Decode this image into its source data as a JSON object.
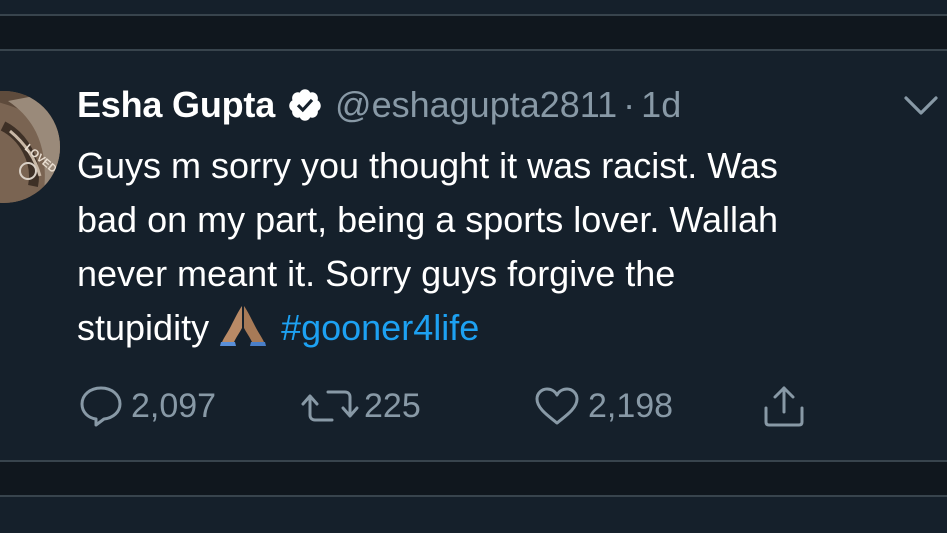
{
  "tweet": {
    "author_name": "Esha Gupta",
    "handle": "@eshagupta2811",
    "separator": "·",
    "time": "1d",
    "text_lines": [
      "Guys m sorry you thought it was racist. Was",
      "bad on my part, being a sports lover. Wallah",
      "never meant it. Sorry guys forgive the",
      "stupidity"
    ],
    "hashtag": "#gooner4life",
    "emoji": "folded-hands-emoji",
    "avatar_text": "LOVED",
    "actions": {
      "replies": "2,097",
      "retweets": "225",
      "likes": "2,198"
    }
  },
  "icons": {
    "verified": "verified-badge-icon",
    "more": "chevron-down-icon",
    "reply": "reply-icon",
    "retweet": "retweet-icon",
    "like": "heart-icon",
    "share": "share-icon"
  },
  "colors": {
    "background": "#15202b",
    "divider": "#38444d",
    "secondary_text": "#8899a6",
    "accent": "#1da1f2"
  }
}
